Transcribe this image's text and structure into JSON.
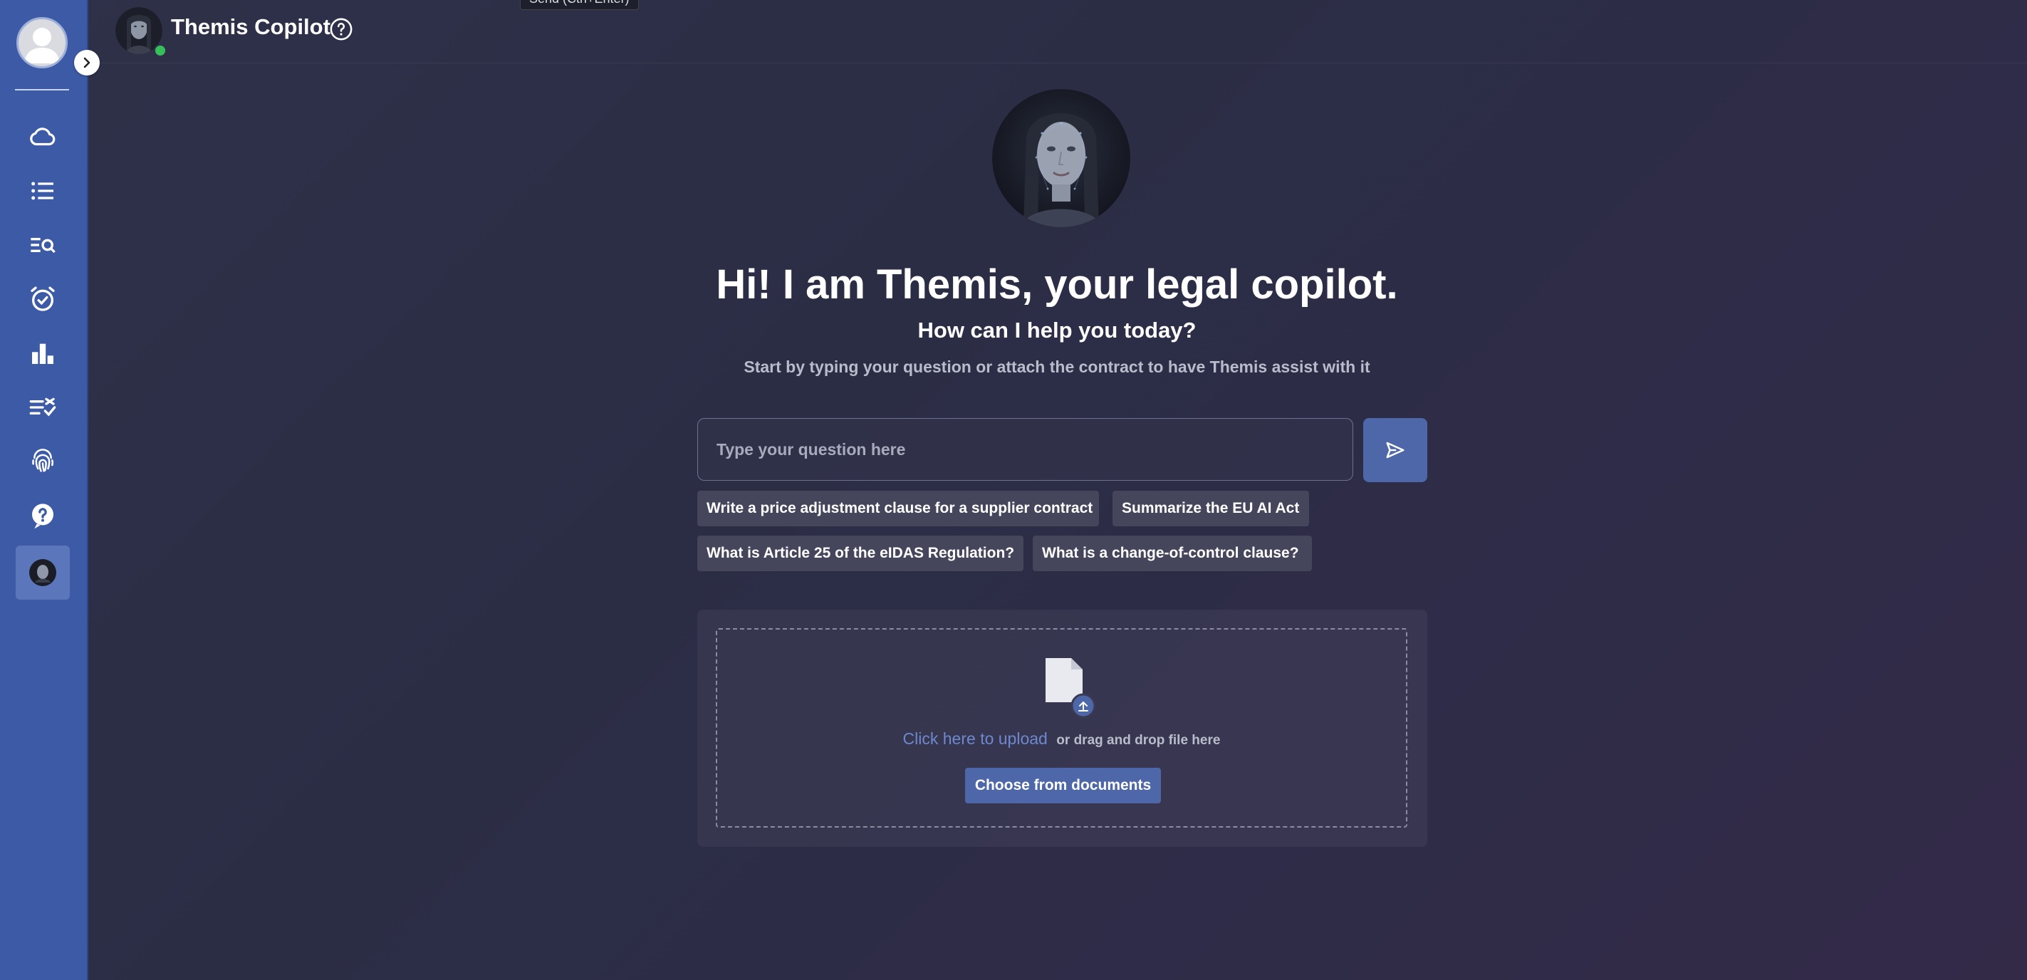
{
  "tooltip": "Send (Ctrl+Enter)",
  "header": {
    "title": "Themis Copilot"
  },
  "sidebar": {
    "items": [
      {
        "icon": "cloud-icon"
      },
      {
        "icon": "list-icon"
      },
      {
        "icon": "search-list-icon"
      },
      {
        "icon": "alarm-check-icon"
      },
      {
        "icon": "bar-chart-icon"
      },
      {
        "icon": "checklist-icon"
      },
      {
        "icon": "fingerprint-icon"
      },
      {
        "icon": "help-icon"
      },
      {
        "icon": "copilot-avatar-icon"
      }
    ]
  },
  "main": {
    "greeting": "Hi! I am Themis, your legal copilot.",
    "subtitle": "How can I help you today?",
    "hint": "Start by typing your question or attach the contract to have Themis assist with it",
    "input_placeholder": "Type your question here",
    "suggestions": [
      "Write a price adjustment clause for a supplier contract",
      "Summarize the EU AI Act",
      "What is Article 25 of the eIDAS Regulation?",
      "What is a change-of-control clause?"
    ],
    "upload": {
      "link": "Click here to upload",
      "text": "or drag and drop file here",
      "choose_button": "Choose from documents"
    }
  },
  "colors": {
    "sidebar": "#3c5aa6",
    "accent": "#4e67a9",
    "background": "#2e3149",
    "online": "#37c05a"
  }
}
